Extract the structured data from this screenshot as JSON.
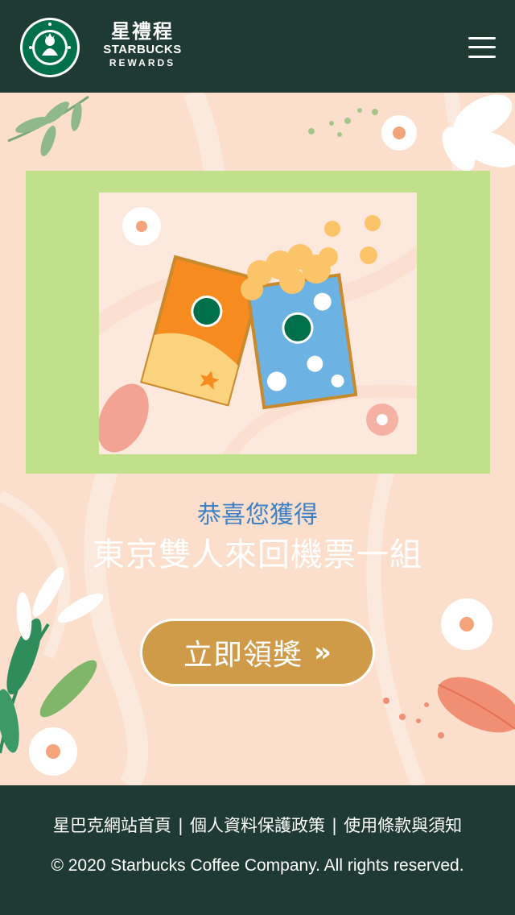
{
  "header": {
    "brand_zh": "星禮程",
    "brand_en": "STARBUCKS",
    "brand_sub": "REWARDS"
  },
  "main": {
    "congrats": "恭喜您獲得",
    "prize_name": "東京雙人來回機票一組",
    "claim_button": {
      "label": "立即領獎",
      "arrow": "»"
    }
  },
  "footer": {
    "links": [
      "星巴克網站首頁",
      "個人資料保護政策",
      "使用條款與須知"
    ],
    "separator": "|",
    "copyright": "© 2020 Starbucks Coffee Company. All rights reserved."
  },
  "colors": {
    "header_bg": "#1f3933",
    "page_bg": "#fbdfcc",
    "frame_green": "#c1e08b",
    "congrats_blue": "#3d80c6",
    "button_gold": "#cf9b48"
  }
}
